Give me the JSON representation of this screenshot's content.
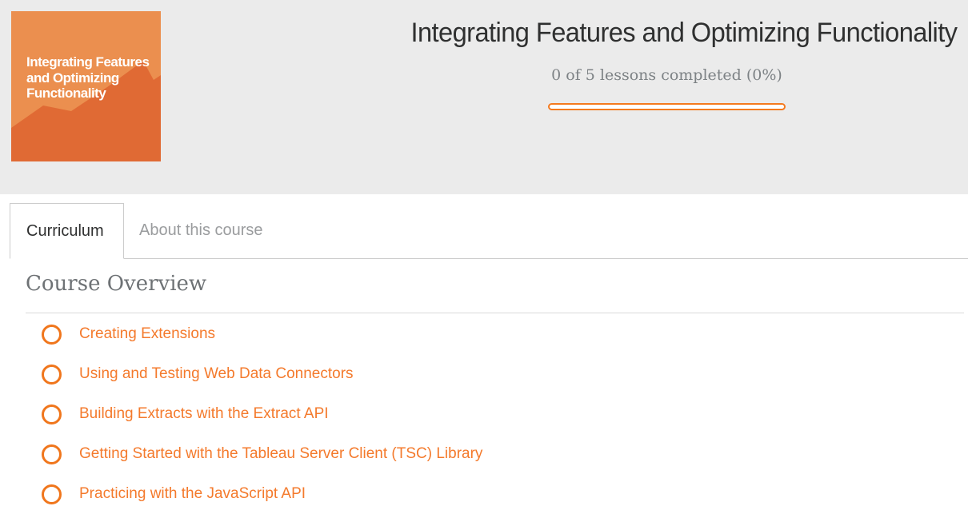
{
  "header": {
    "thumbnail_text": "Integrating Features and Optimizing Functionality",
    "title": "Integrating Features and Optimizing Functionality",
    "progress_text": "0 of 5 lessons completed (0%)",
    "progress_percent": 0,
    "accent_color": "#f47a1f"
  },
  "tabs": [
    {
      "label": "Curriculum",
      "active": true
    },
    {
      "label": "About this course",
      "active": false
    }
  ],
  "curriculum": {
    "section_title": "Course Overview",
    "lessons": [
      {
        "label": "Creating Extensions",
        "status": "incomplete",
        "icon": "circle-outline-icon"
      },
      {
        "label": "Using and Testing Web Data Connectors",
        "status": "incomplete",
        "icon": "circle-outline-icon"
      },
      {
        "label": "Building Extracts with the Extract API",
        "status": "incomplete",
        "icon": "circle-outline-icon"
      },
      {
        "label": "Getting Started with the Tableau Server Client (TSC) Library",
        "status": "incomplete",
        "icon": "circle-outline-icon"
      },
      {
        "label": "Practicing with the JavaScript API",
        "status": "incomplete",
        "icon": "circle-outline-icon"
      }
    ]
  }
}
